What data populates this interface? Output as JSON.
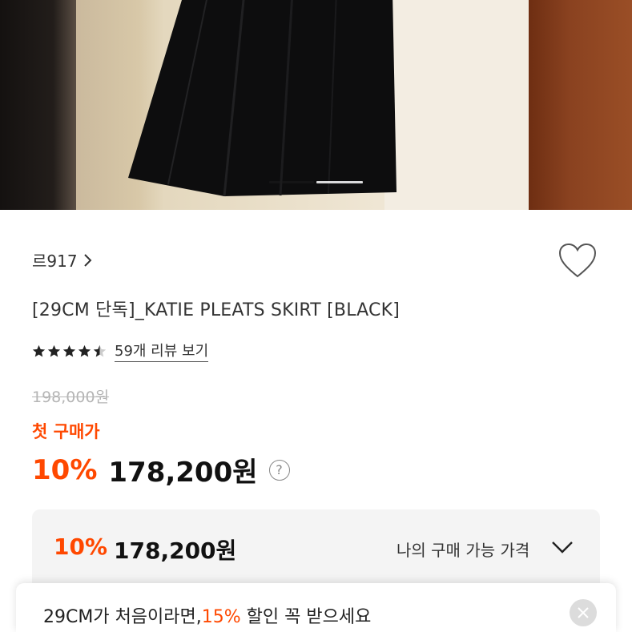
{
  "product": {
    "brand": "르917",
    "title": "[29CM 단독]_KATIE PLEATS SKIRT [BLACK]",
    "rating": 4.5,
    "review_link": "59개 리뷰 보기",
    "original_price": "198,000원",
    "first_purchase_label": "첫 구매가",
    "discount": "10%",
    "price": "178,200원",
    "help_icon": "?"
  },
  "my_price": {
    "discount": "10%",
    "price": "178,200원",
    "label": "나의 구매 가능 가격"
  },
  "banner": {
    "text_before": "29CM가 처음이라면,",
    "accent": "15%",
    "text_after": " 할인 꼭 받으세요"
  },
  "carousel": {
    "current_index": 2,
    "total": 2
  },
  "colors": {
    "accent": "#ff4800",
    "box_bg": "#f4f4f4"
  },
  "icons": [
    "chevron-right-icon",
    "heart-icon",
    "star-icon",
    "help-icon",
    "chevron-down-icon",
    "close-icon"
  ]
}
